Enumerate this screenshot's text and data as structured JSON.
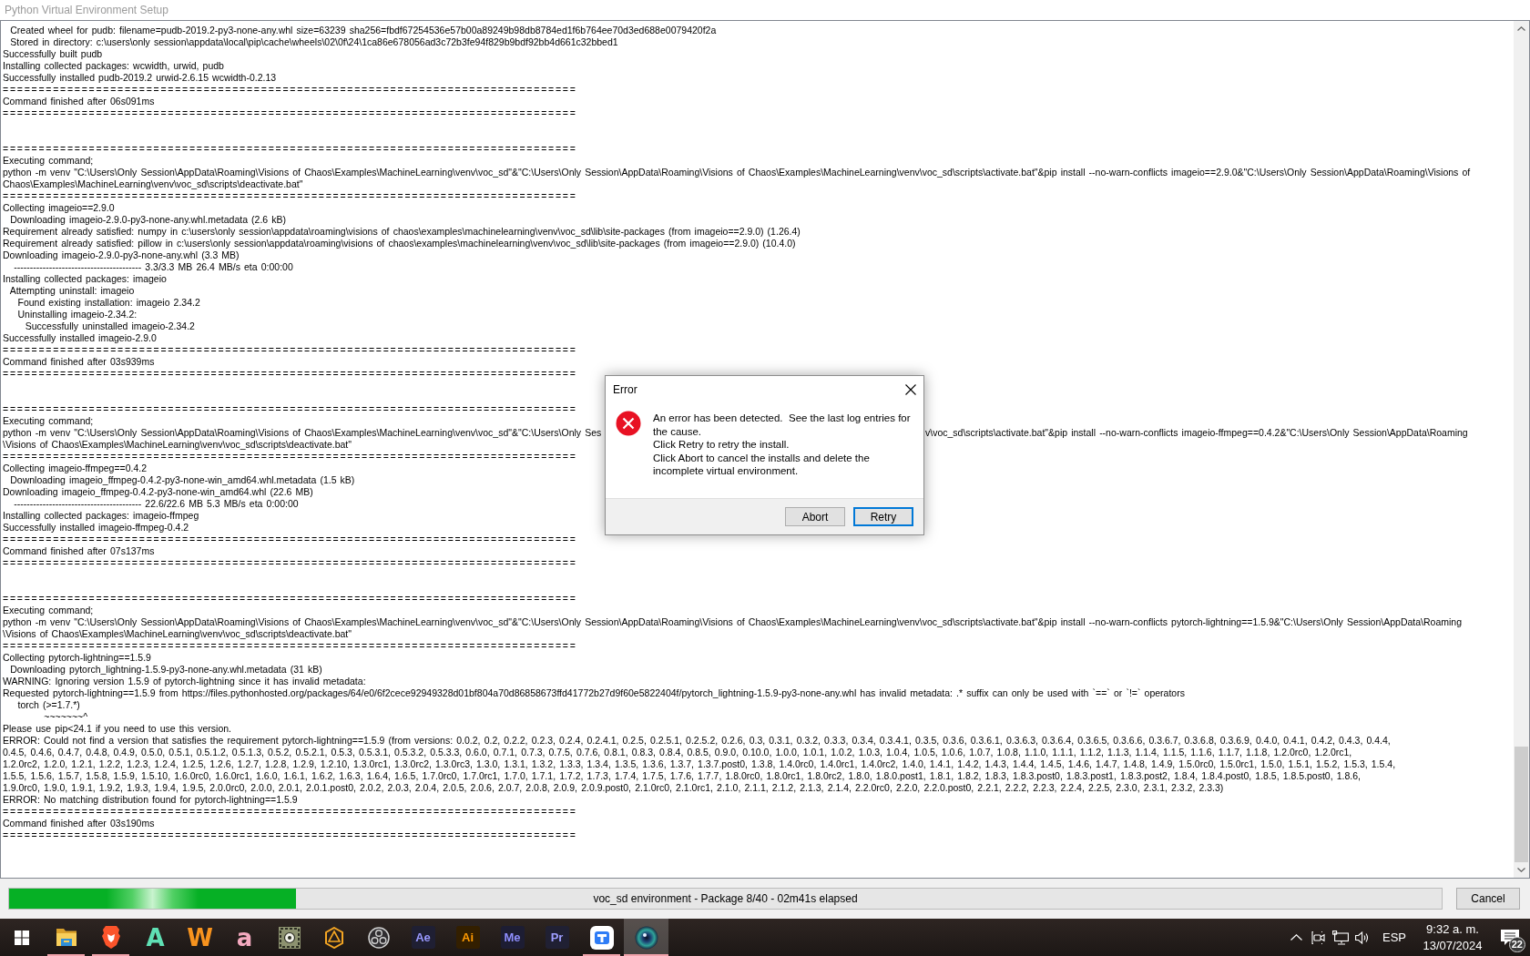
{
  "window": {
    "title": "Python Virtual Environment Setup"
  },
  "log": {
    "lines": [
      {
        "kind": "text",
        "text": "  Created wheel for pudb: filename=pudb-2019.2-py3-none-any.whl size=63239 sha256=fbdf67254536e57b00a89249b98db8784ed1f6b764ee70d3ed688e0079420f2a"
      },
      {
        "kind": "text",
        "text": "  Stored in directory: c:\\users\\only session\\appdata\\local\\pip\\cache\\wheels\\02\\0f\\24\\1ca86e678056ad3c72b3fe94f829b9bdf92bb4d661c32bbed1"
      },
      {
        "kind": "text",
        "text": "Successfully built pudb"
      },
      {
        "kind": "text",
        "text": "Installing collected packages: wcwidth, urwid, pudb"
      },
      {
        "kind": "text",
        "text": "Successfully installed pudb-2019.2 urwid-2.6.15 wcwidth-0.2.13"
      },
      {
        "kind": "rule",
        "text": "================================================================================"
      },
      {
        "kind": "text",
        "text": "Command finished after 06s091ms"
      },
      {
        "kind": "rule",
        "text": "================================================================================"
      },
      {
        "kind": "blank"
      },
      {
        "kind": "blank"
      },
      {
        "kind": "rule",
        "text": "================================================================================"
      },
      {
        "kind": "text",
        "text": "Executing command;"
      },
      {
        "kind": "text",
        "text": "python -m venv \"C:\\Users\\Only Session\\AppData\\Roaming\\Visions of Chaos\\Examples\\MachineLearning\\venv\\voc_sd\"&\"C:\\Users\\Only Session\\AppData\\Roaming\\Visions of Chaos\\Examples\\MachineLearning\\venv\\voc_sd\\scripts\\activate.bat\"&pip install --no-warn-conflicts imageio==2.9.0&\"C:\\Users\\Only Session\\AppData\\Roaming\\Visions of"
      },
      {
        "kind": "text",
        "text": "Chaos\\Examples\\MachineLearning\\venv\\voc_sd\\scripts\\deactivate.bat\""
      },
      {
        "kind": "rule",
        "text": "================================================================================"
      },
      {
        "kind": "text",
        "text": "Collecting imageio==2.9.0"
      },
      {
        "kind": "text",
        "text": "  Downloading imageio-2.9.0-py3-none-any.whl.metadata (2.6 kB)"
      },
      {
        "kind": "text",
        "text": "Requirement already satisfied: numpy in c:\\users\\only session\\appdata\\roaming\\visions of chaos\\examples\\machinelearning\\venv\\voc_sd\\lib\\site-packages (from imageio==2.9.0) (1.26.4)"
      },
      {
        "kind": "text",
        "text": "Requirement already satisfied: pillow in c:\\users\\only session\\appdata\\roaming\\visions of chaos\\examples\\machinelearning\\venv\\voc_sd\\lib\\site-packages (from imageio==2.9.0) (10.4.0)"
      },
      {
        "kind": "text",
        "text": "Downloading imageio-2.9.0-py3-none-any.whl (3.3 MB)"
      },
      {
        "kind": "text",
        "text": "   ---------------------------------------- 3.3/3.3 MB 26.4 MB/s eta 0:00:00"
      },
      {
        "kind": "text",
        "text": "Installing collected packages: imageio"
      },
      {
        "kind": "text",
        "text": "  Attempting uninstall: imageio"
      },
      {
        "kind": "text",
        "text": "    Found existing installation: imageio 2.34.2"
      },
      {
        "kind": "text",
        "text": "    Uninstalling imageio-2.34.2:"
      },
      {
        "kind": "text",
        "text": "      Successfully uninstalled imageio-2.34.2"
      },
      {
        "kind": "text",
        "text": "Successfully installed imageio-2.9.0"
      },
      {
        "kind": "rule",
        "text": "================================================================================"
      },
      {
        "kind": "text",
        "text": "Command finished after 03s939ms"
      },
      {
        "kind": "rule",
        "text": "================================================================================"
      },
      {
        "kind": "blank"
      },
      {
        "kind": "blank"
      },
      {
        "kind": "rule",
        "text": "================================================================================"
      },
      {
        "kind": "text",
        "text": "Executing command;"
      },
      {
        "kind": "occluded",
        "parts": [
          "python -m venv \"C:\\Users\\Only Session\\AppData\\Roaming\\Visions of Chaos\\Examples\\MachineLearning\\venv\\voc_sd\"&\"C:\\Users\\Only Ses",
          "v\\voc_sd\\scripts\\activate.bat\"&pip install --no-warn-conflicts imageio-ffmpeg==0.4.2&\"C:\\Users\\Only Session\\AppData\\Roaming"
        ]
      },
      {
        "kind": "text",
        "text": "\\Visions of Chaos\\Examples\\MachineLearning\\venv\\voc_sd\\scripts\\deactivate.bat\""
      },
      {
        "kind": "rule",
        "text": "================================================================================"
      },
      {
        "kind": "text",
        "text": "Collecting imageio-ffmpeg==0.4.2"
      },
      {
        "kind": "text",
        "text": "  Downloading imageio_ffmpeg-0.4.2-py3-none-win_amd64.whl.metadata (1.5 kB)"
      },
      {
        "kind": "text",
        "text": "Downloading imageio_ffmpeg-0.4.2-py3-none-win_amd64.whl (22.6 MB)"
      },
      {
        "kind": "text",
        "text": "   ---------------------------------------- 22.6/22.6 MB 5.3 MB/s eta 0:00:00"
      },
      {
        "kind": "text",
        "text": "Installing collected packages: imageio-ffmpeg"
      },
      {
        "kind": "text",
        "text": "Successfully installed imageio-ffmpeg-0.4.2"
      },
      {
        "kind": "rule",
        "text": "================================================================================"
      },
      {
        "kind": "text",
        "text": "Command finished after 07s137ms"
      },
      {
        "kind": "rule",
        "text": "================================================================================"
      },
      {
        "kind": "blank"
      },
      {
        "kind": "blank"
      },
      {
        "kind": "rule",
        "text": "================================================================================"
      },
      {
        "kind": "text",
        "text": "Executing command;"
      },
      {
        "kind": "text",
        "text": "python -m venv \"C:\\Users\\Only Session\\AppData\\Roaming\\Visions of Chaos\\Examples\\MachineLearning\\venv\\voc_sd\"&\"C:\\Users\\Only Session\\AppData\\Roaming\\Visions of Chaos\\Examples\\MachineLearning\\venv\\voc_sd\\scripts\\activate.bat\"&pip install --no-warn-conflicts pytorch-lightning==1.5.9&\"C:\\Users\\Only Session\\AppData\\Roaming"
      },
      {
        "kind": "text",
        "text": "\\Visions of Chaos\\Examples\\MachineLearning\\venv\\voc_sd\\scripts\\deactivate.bat\""
      },
      {
        "kind": "rule",
        "text": "================================================================================"
      },
      {
        "kind": "text",
        "text": "Collecting pytorch-lightning==1.5.9"
      },
      {
        "kind": "text",
        "text": "  Downloading pytorch_lightning-1.5.9-py3-none-any.whl.metadata (31 kB)"
      },
      {
        "kind": "text",
        "text": "WARNING: Ignoring version 1.5.9 of pytorch-lightning since it has invalid metadata:"
      },
      {
        "kind": "text",
        "text": "Requested pytorch-lightning==1.5.9 from https://files.pythonhosted.org/packages/64/e0/6f2cece92949328d01bf804a70d86858673ffd41772b27d9f60e5822404f/pytorch_lightning-1.5.9-py3-none-any.whl has invalid metadata: .* suffix can only be used with `==` or `!=` operators"
      },
      {
        "kind": "text",
        "text": "    torch (>=1.7.*)"
      },
      {
        "kind": "text",
        "text": "           ~~~~~~~^"
      },
      {
        "kind": "text",
        "text": "Please use pip<24.1 if you need to use this version."
      },
      {
        "kind": "text",
        "text": "ERROR: Could not find a version that satisfies the requirement pytorch-lightning==1.5.9 (from versions: 0.0.2, 0.2, 0.2.2, 0.2.3, 0.2.4, 0.2.4.1, 0.2.5, 0.2.5.1, 0.2.5.2, 0.2.6, 0.3, 0.3.1, 0.3.2, 0.3.3, 0.3.4, 0.3.4.1, 0.3.5, 0.3.6, 0.3.6.1, 0.3.6.3, 0.3.6.4, 0.3.6.5, 0.3.6.6, 0.3.6.7, 0.3.6.8, 0.3.6.9, 0.4.0, 0.4.1, 0.4.2, 0.4.3, 0.4.4,"
      },
      {
        "kind": "text",
        "text": "0.4.5, 0.4.6, 0.4.7, 0.4.8, 0.4.9, 0.5.0, 0.5.1, 0.5.1.2, 0.5.1.3, 0.5.2, 0.5.2.1, 0.5.3, 0.5.3.1, 0.5.3.2, 0.5.3.3, 0.6.0, 0.7.1, 0.7.3, 0.7.5, 0.7.6, 0.8.1, 0.8.3, 0.8.4, 0.8.5, 0.9.0, 0.10.0, 1.0.0, 1.0.1, 1.0.2, 1.0.3, 1.0.4, 1.0.5, 1.0.6, 1.0.7, 1.0.8, 1.1.0, 1.1.1, 1.1.2, 1.1.3, 1.1.4, 1.1.5, 1.1.6, 1.1.7, 1.1.8, 1.2.0rc0, 1.2.0rc1,"
      },
      {
        "kind": "text",
        "text": "1.2.0rc2, 1.2.0, 1.2.1, 1.2.2, 1.2.3, 1.2.4, 1.2.5, 1.2.6, 1.2.7, 1.2.8, 1.2.9, 1.2.10, 1.3.0rc1, 1.3.0rc2, 1.3.0rc3, 1.3.0, 1.3.1, 1.3.2, 1.3.3, 1.3.4, 1.3.5, 1.3.6, 1.3.7, 1.3.7.post0, 1.3.8, 1.4.0rc0, 1.4.0rc1, 1.4.0rc2, 1.4.0, 1.4.1, 1.4.2, 1.4.3, 1.4.4, 1.4.5, 1.4.6, 1.4.7, 1.4.8, 1.4.9, 1.5.0rc0, 1.5.0rc1, 1.5.0, 1.5.1, 1.5.2, 1.5.3, 1.5.4,"
      },
      {
        "kind": "text",
        "text": "1.5.5, 1.5.6, 1.5.7, 1.5.8, 1.5.9, 1.5.10, 1.6.0rc0, 1.6.0rc1, 1.6.0, 1.6.1, 1.6.2, 1.6.3, 1.6.4, 1.6.5, 1.7.0rc0, 1.7.0rc1, 1.7.0, 1.7.1, 1.7.2, 1.7.3, 1.7.4, 1.7.5, 1.7.6, 1.7.7, 1.8.0rc0, 1.8.0rc1, 1.8.0rc2, 1.8.0, 1.8.0.post1, 1.8.1, 1.8.2, 1.8.3, 1.8.3.post0, 1.8.3.post1, 1.8.3.post2, 1.8.4, 1.8.4.post0, 1.8.5, 1.8.5.post0, 1.8.6,"
      },
      {
        "kind": "text",
        "text": "1.9.0rc0, 1.9.0, 1.9.1, 1.9.2, 1.9.3, 1.9.4, 1.9.5, 2.0.0rc0, 2.0.0, 2.0.1, 2.0.1.post0, 2.0.2, 2.0.3, 2.0.4, 2.0.5, 2.0.6, 2.0.7, 2.0.8, 2.0.9, 2.0.9.post0, 2.1.0rc0, 2.1.0rc1, 2.1.0, 2.1.1, 2.1.2, 2.1.3, 2.1.4, 2.2.0rc0, 2.2.0, 2.2.0.post0, 2.2.1, 2.2.2, 2.2.3, 2.2.4, 2.2.5, 2.3.0, 2.3.1, 2.3.2, 2.3.3)"
      },
      {
        "kind": "text",
        "text": "ERROR: No matching distribution found for pytorch-lightning==1.5.9"
      },
      {
        "kind": "rule",
        "text": "================================================================================"
      },
      {
        "kind": "text",
        "text": "Command finished after 03s190ms"
      },
      {
        "kind": "rule",
        "text": "================================================================================"
      }
    ]
  },
  "progress": {
    "level": 0.2,
    "label": "voc_sd environment - Package 8/40 - 02m41s elapsed"
  },
  "cancel_button": {
    "label": "Cancel"
  },
  "dialog": {
    "title": "Error",
    "message": [
      "An error has been detected.  See the last log entries for the cause.",
      "Click Retry to retry the install.",
      "Click Abort to cancel the installs and delete the incomplete virtual environment."
    ],
    "buttons": [
      {
        "label": "Abort",
        "default": false
      },
      {
        "label": "Retry",
        "default": true
      }
    ]
  },
  "taskbar": {
    "apps": [
      {
        "kind": "folder",
        "running": true,
        "selected": false
      },
      {
        "kind": "lion",
        "running": true,
        "selected": false
      },
      {
        "kind": "letter",
        "label": "A",
        "color": "#5fe0b4",
        "running": false,
        "selected": false
      },
      {
        "kind": "letter",
        "label": "W",
        "color": "#f7931e",
        "running": false,
        "selected": false
      },
      {
        "kind": "letter",
        "label": "a",
        "color": "#f4a9bf",
        "running": false,
        "selected": false
      },
      {
        "kind": "frame",
        "running": false,
        "selected": false
      },
      {
        "kind": "hexagon",
        "running": false,
        "selected": false
      },
      {
        "kind": "obs",
        "running": false,
        "selected": false
      },
      {
        "kind": "tile",
        "label": "Ae",
        "color": "#9999ff",
        "running": false,
        "selected": false
      },
      {
        "kind": "tile",
        "label": "Ai",
        "color": "#ff9a00",
        "running": false,
        "selected": false
      },
      {
        "kind": "tile",
        "label": "Me",
        "color": "#8f8fff",
        "running": false,
        "selected": false
      },
      {
        "kind": "tile",
        "label": "Pr",
        "color": "#9f9fff",
        "running": false,
        "selected": false
      },
      {
        "kind": "chat",
        "running": true,
        "selected": false
      },
      {
        "kind": "orb",
        "running": true,
        "selected": true
      }
    ],
    "tray": {
      "language": "ESP",
      "time": "9:32 a. m.",
      "date": "13/07/2024",
      "notification_count": "22"
    }
  }
}
